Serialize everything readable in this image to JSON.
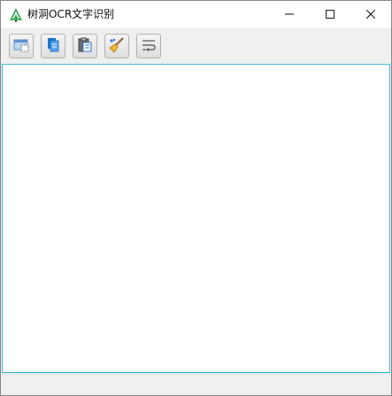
{
  "window": {
    "title": "树洞OCR文字识别",
    "controls": {
      "minimize_icon": "minimize-icon",
      "maximize_icon": "maximize-icon",
      "close_icon": "close-icon"
    }
  },
  "toolbar": {
    "buttons": [
      {
        "id": "screenshot",
        "icon": "screenshot-icon"
      },
      {
        "id": "open-file",
        "icon": "file-icon"
      },
      {
        "id": "paste",
        "icon": "clipboard-icon"
      },
      {
        "id": "clear",
        "icon": "broom-icon"
      },
      {
        "id": "wrap",
        "icon": "text-wrap-icon"
      }
    ]
  },
  "editor": {
    "value": ""
  },
  "statusbar": {
    "text": ""
  },
  "colors": {
    "accent": "#2fb3d1",
    "title_bg": "#ffffff",
    "chrome_bg": "#f0f0f0"
  }
}
